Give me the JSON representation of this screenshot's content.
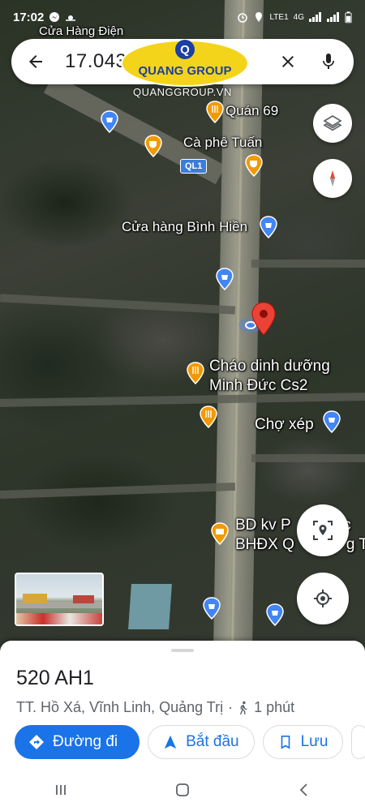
{
  "status_bar": {
    "time": "17:02",
    "network": "LTE1",
    "network_type": "4G"
  },
  "search": {
    "query": "17.043"
  },
  "watermark": {
    "brand": "QUANG GROUP",
    "letter": "Q",
    "site": "QUANGGROUP.VN"
  },
  "map": {
    "road_shield": "QL1",
    "labels": [
      {
        "text": "Cửa Hàng Điện",
        "icon": "shop-icon"
      },
      {
        "text": "Quán 69",
        "icon": "restaurant-icon"
      },
      {
        "text": "Cà phê Tuấn",
        "icon": "cafe-icon"
      },
      {
        "text": "Cửa hàng Bình Hiền",
        "icon": "shop-icon"
      },
      {
        "text": "Cháo dinh dưỡng",
        "text2": "Minh Đức Cs2",
        "icon": "restaurant-icon"
      },
      {
        "text": "Chợ xép",
        "icon": "shop-icon"
      },
      {
        "text": "BD kv P",
        "text_b": "ắc",
        "text2": "BHĐX Q",
        "text2_b": "g Tr",
        "icon": "briefcase-icon"
      }
    ]
  },
  "place": {
    "title": "520 AH1",
    "address": "TT. Hồ Xá, Vĩnh Linh, Quảng Trị",
    "separator": "·",
    "walk_time": "1 phút"
  },
  "actions": {
    "directions": "Đường đi",
    "start": "Bắt đầu",
    "save": "Lưu"
  },
  "colors": {
    "accent": "#1a73e8",
    "pin_red": "#ea4335",
    "food_pin": "#f29900",
    "shop_pin": "#4285f4"
  }
}
